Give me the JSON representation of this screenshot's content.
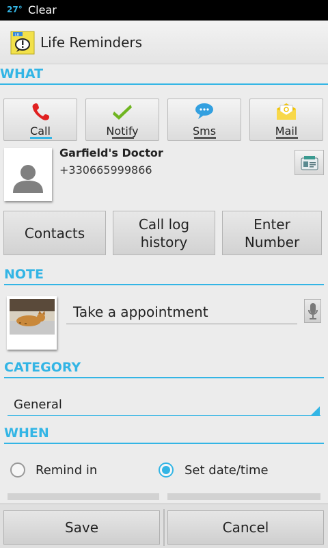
{
  "status_bar": {
    "temperature": "27°",
    "weather": "Clear"
  },
  "action_bar": {
    "title": "Life Reminders",
    "icon_text": "LR"
  },
  "what": {
    "header": "WHAT",
    "types": [
      {
        "label": "Call",
        "icon": "phone-icon",
        "active": true
      },
      {
        "label": "Notify",
        "icon": "checkmark-icon",
        "active": false
      },
      {
        "label": "Sms",
        "icon": "speech-bubble-icon",
        "active": false
      },
      {
        "label": "Mail",
        "icon": "envelope-icon",
        "active": false
      }
    ],
    "contact": {
      "name": "Garfield's Doctor",
      "phone": "+330665999866"
    },
    "source_buttons": {
      "contacts": "Contacts",
      "call_log_1": "Call log",
      "call_log_2": "history",
      "enter_number_1": "Enter",
      "enter_number_2": "Number"
    }
  },
  "note": {
    "header": "NOTE",
    "value": "Take a appointment"
  },
  "category": {
    "header": "CATEGORY",
    "selected": "General"
  },
  "when": {
    "header": "WHEN",
    "remind_in": "Remind in",
    "set_datetime": "Set date/time",
    "selected": "set_datetime"
  },
  "footer": {
    "save": "Save",
    "cancel": "Cancel"
  },
  "colors": {
    "accent": "#33b5e5",
    "call_red": "#e02020",
    "notify_green": "#6fb520",
    "sms_blue": "#33a0e0",
    "mail_yellow": "#f2c300"
  }
}
